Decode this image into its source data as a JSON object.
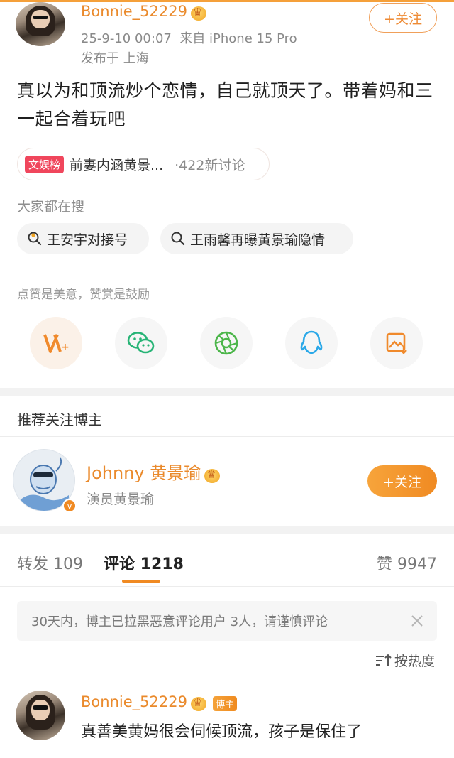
{
  "post": {
    "author": "Bonnie_52229",
    "timestamp": "25-9-10 00:07",
    "source": "来自 iPhone 15 Pro",
    "location": "发布于 上海",
    "follow_label": "+关注",
    "text": "真以为和顶流炒个恋情，自己就顶天了。带着妈和三一起合着玩吧"
  },
  "topic": {
    "tag": "文娱榜",
    "title": "前妻内涵黄景...",
    "count": "·422新讨论"
  },
  "searches": {
    "label": "大家都在搜",
    "items": [
      "王安宇对接号",
      "王雨馨再曝黄景瑜隐情"
    ]
  },
  "reward": {
    "label": "点赞是美意，赞赏是鼓励"
  },
  "share_icons": [
    "weibo-reward-icon",
    "wechat-icon",
    "moments-icon",
    "qq-icon",
    "save-image-icon"
  ],
  "recommend": {
    "section_title": "推荐关注博主",
    "name": "Johnny 黄景瑜",
    "desc": "演员黄景瑜",
    "follow_label": "+关注"
  },
  "tabs": {
    "repost": "转发 109",
    "comments": "评论 1218",
    "likes": "赞 9947"
  },
  "notice": {
    "text": "30天内，博主已拉黑恶意评论用户 3人，请谨慎评论"
  },
  "sort": {
    "label": "按热度"
  },
  "comment": {
    "author": "Bonnie_52229",
    "badge": "博主",
    "text": "真善美黄妈很会伺候顶流，孩子是保住了"
  },
  "colors": {
    "accent": "#ee8a34",
    "brand_red": "#f0465c",
    "text": "#1f1f1f",
    "muted": "#8a8a8a"
  }
}
